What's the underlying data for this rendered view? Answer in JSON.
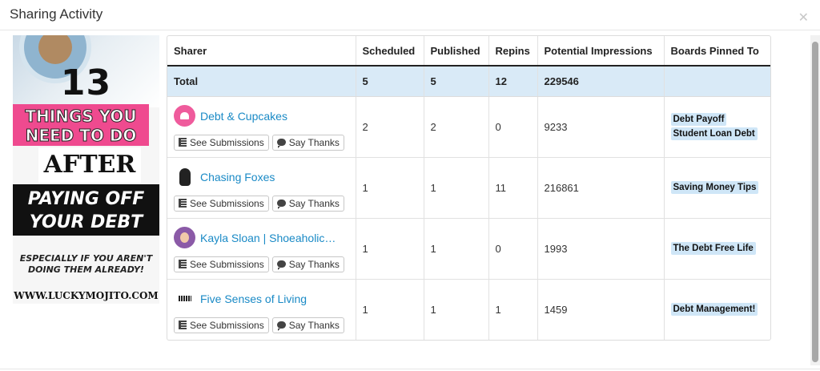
{
  "dialog": {
    "title": "Sharing Activity",
    "close_icon": "close-icon"
  },
  "pin_image": {
    "line1": "13",
    "line2": "THINGS YOU NEED TO DO",
    "line3": "AFTER",
    "line4": "PAYING OFF YOUR DEBT",
    "line5": "ESPECIALLY IF YOU AREN'T DOING THEM ALREADY!",
    "line6": "WWW.LUCKYMOJITO.COM",
    "colors": {
      "pink": "#ef4a8f",
      "black": "#111111"
    }
  },
  "table": {
    "headers": {
      "sharer": "Sharer",
      "scheduled": "Scheduled",
      "published": "Published",
      "repins": "Repins",
      "impressions": "Potential Impressions",
      "boards": "Boards Pinned To"
    },
    "total": {
      "label": "Total",
      "scheduled": "5",
      "published": "5",
      "repins": "12",
      "impressions": "229546"
    },
    "buttons": {
      "see_submissions": "See Submissions",
      "say_thanks": "Say Thanks"
    },
    "rows": [
      {
        "name": "Debt & Cupcakes",
        "scheduled": "2",
        "published": "2",
        "repins": "0",
        "impressions": "9233",
        "boards": [
          "Debt Payoff",
          "Student Loan Debt"
        ]
      },
      {
        "name": "Chasing Foxes",
        "scheduled": "1",
        "published": "1",
        "repins": "11",
        "impressions": "216861",
        "boards": [
          "Saving Money Tips"
        ]
      },
      {
        "name": "Kayla Sloan | Shoeaholic…",
        "scheduled": "1",
        "published": "1",
        "repins": "0",
        "impressions": "1993",
        "boards": [
          "The Debt Free Life"
        ]
      },
      {
        "name": "Five Senses of Living",
        "scheduled": "1",
        "published": "1",
        "repins": "1",
        "impressions": "1459",
        "boards": [
          "Debt Management!"
        ]
      }
    ]
  },
  "colors": {
    "link": "#1a8ac6",
    "total_bg": "#d9eaf7",
    "board_bg": "#cfe6f7"
  }
}
